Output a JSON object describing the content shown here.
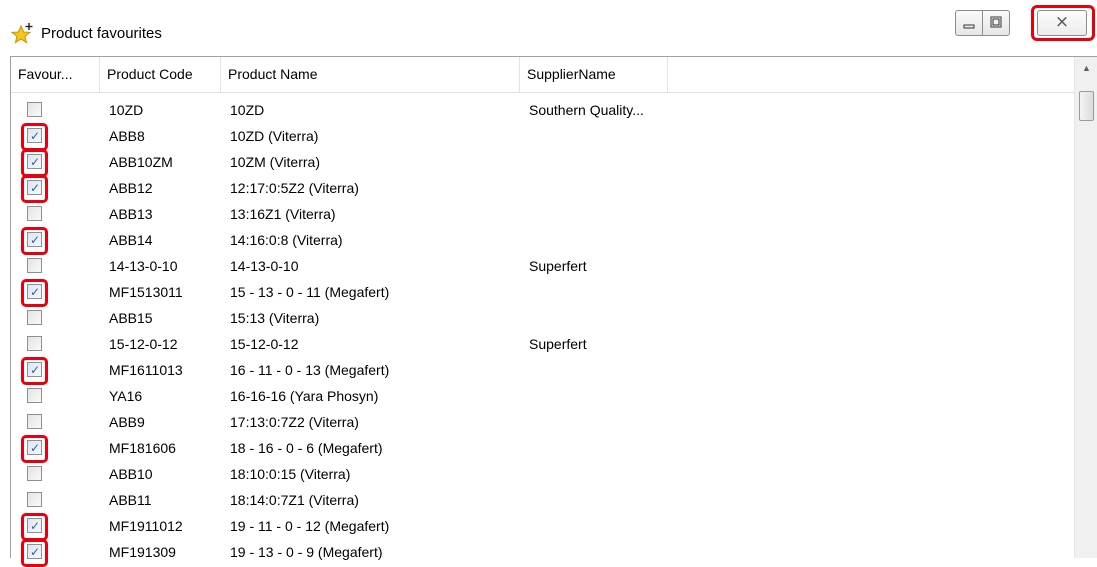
{
  "window": {
    "title": "Product favourites",
    "icon": "star-plus-icon",
    "controls": [
      "minimize-icon",
      "maximize-icon",
      "close-icon"
    ],
    "close_glyph": "⨯"
  },
  "columns": [
    "Favour...",
    "Product Code",
    "Product Name",
    "SupplierName"
  ],
  "rows": [
    {
      "checked": false,
      "code": "10ZD",
      "name": "10ZD",
      "supplier": "Southern Quality..."
    },
    {
      "checked": true,
      "code": "ABB8",
      "name": "10ZD (Viterra)",
      "supplier": ""
    },
    {
      "checked": true,
      "code": "ABB10ZM",
      "name": "10ZM (Viterra)",
      "supplier": ""
    },
    {
      "checked": true,
      "code": "ABB12",
      "name": "12:17:0:5Z2 (Viterra)",
      "supplier": ""
    },
    {
      "checked": false,
      "code": "ABB13",
      "name": "13:16Z1 (Viterra)",
      "supplier": ""
    },
    {
      "checked": true,
      "code": "ABB14",
      "name": "14:16:0:8 (Viterra)",
      "supplier": ""
    },
    {
      "checked": false,
      "code": "14-13-0-10",
      "name": "14-13-0-10",
      "supplier": "Superfert"
    },
    {
      "checked": true,
      "code": "MF1513011",
      "name": "15 - 13 - 0 - 11 (Megafert)",
      "supplier": ""
    },
    {
      "checked": false,
      "code": "ABB15",
      "name": "15:13 (Viterra)",
      "supplier": ""
    },
    {
      "checked": false,
      "code": "15-12-0-12",
      "name": "15-12-0-12",
      "supplier": "Superfert"
    },
    {
      "checked": true,
      "code": "MF1611013",
      "name": "16 - 11 - 0 - 13 (Megafert)",
      "supplier": ""
    },
    {
      "checked": false,
      "code": "YA16",
      "name": "16-16-16 (Yara Phosyn)",
      "supplier": ""
    },
    {
      "checked": false,
      "code": "ABB9",
      "name": "17:13:0:7Z2 (Viterra)",
      "supplier": ""
    },
    {
      "checked": true,
      "code": "MF181606",
      "name": "18 - 16 - 0 - 6 (Megafert)",
      "supplier": ""
    },
    {
      "checked": false,
      "code": "ABB10",
      "name": "18:10:0:15 (Viterra)",
      "supplier": ""
    },
    {
      "checked": false,
      "code": "ABB11",
      "name": "18:14:0:7Z1 (Viterra)",
      "supplier": ""
    },
    {
      "checked": true,
      "code": "MF1911012",
      "name": "19 - 11 - 0 - 12 (Megafert)",
      "supplier": ""
    },
    {
      "checked": true,
      "code": "MF191309",
      "name": "19 - 13 - 0 - 9 (Megafert)",
      "supplier": ""
    }
  ],
  "colors": {
    "highlight": "#e8000e",
    "check": "#3a5fa8"
  }
}
